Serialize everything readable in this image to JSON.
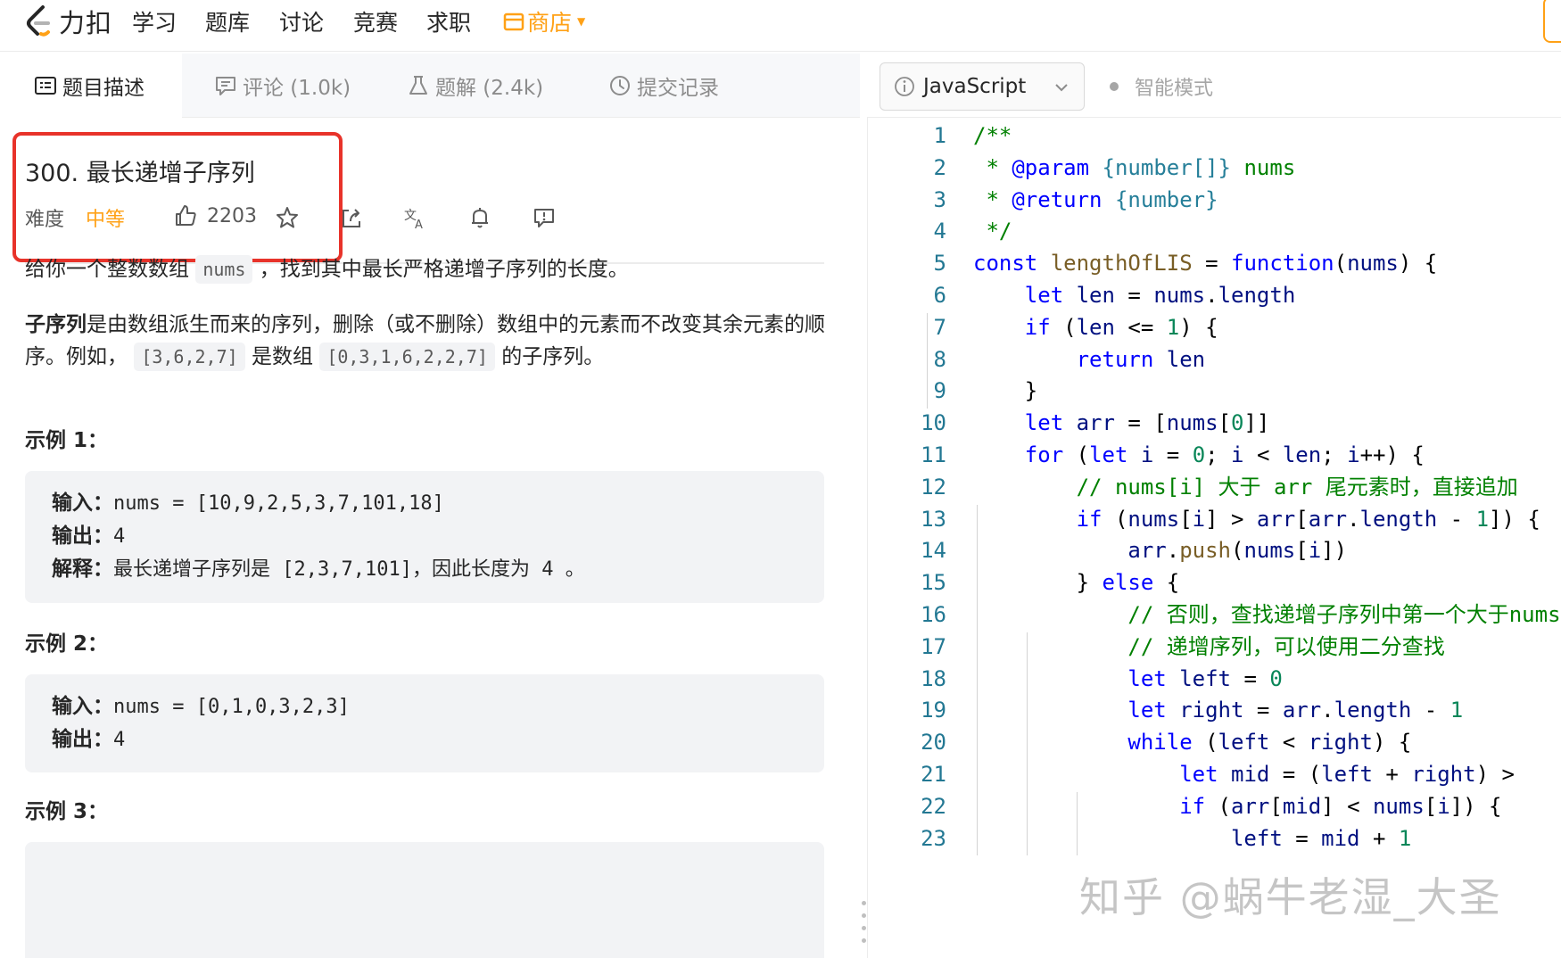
{
  "nav": {
    "logo_text": "力扣",
    "items": [
      "学习",
      "题库",
      "讨论",
      "竞赛",
      "求职"
    ],
    "shop_label": "商店"
  },
  "tabs": [
    {
      "label": "题目描述",
      "icon": "description-icon"
    },
    {
      "label": "评论 (1.0k)",
      "icon": "comment-icon"
    },
    {
      "label": "题解 (2.4k)",
      "icon": "flask-icon"
    },
    {
      "label": "提交记录",
      "icon": "clock-icon"
    }
  ],
  "toolbar": {
    "language": "JavaScript",
    "mode": "智能模式"
  },
  "problem": {
    "title": "300. 最长递增子序列",
    "difficulty_label": "难度",
    "difficulty": "中等",
    "likes": "2203",
    "para1_pre": "给你一个整数数组",
    "para1_code": "nums",
    "para1_post": "，找到其中最长严格递增子序列的长度。",
    "para2_bold": "子序列",
    "para2_a": "是由数组派生而来的序列，删除（或不删除）数组中的元素而不改变其余元素的顺序。例如，",
    "para2_code1": "[3,6,2,7]",
    "para2_b": "是数组",
    "para2_code2": "[0,3,1,6,2,2,7]",
    "para2_c": "的子序列。"
  },
  "examples": [
    {
      "title": "示例 1：",
      "input_label": "输入：",
      "input": "nums = [10,9,2,5,3,7,101,18]",
      "output_label": "输出：",
      "output": "4",
      "explain_label": "解释：",
      "explain_a": "最长递增子序列是",
      "explain_code": " [2,3,7,101]",
      "explain_b": "，因此长度为",
      "explain_num": " 4 ",
      "explain_c": "。"
    },
    {
      "title": "示例 2：",
      "input_label": "输入：",
      "input": "nums = [0,1,0,3,2,3]",
      "output_label": "输出：",
      "output": "4"
    },
    {
      "title": "示例 3："
    }
  ],
  "code_lines": [
    "/**",
    " * @param {number[]} nums",
    " * @return {number}",
    " */",
    "const lengthOfLIS = function(nums) {",
    "    let len = nums.length",
    "    if (len <= 1) {",
    "        return len",
    "    }",
    "    let arr = [nums[0]]",
    "    for (let i = 0; i < len; i++) {",
    "        // nums[i] 大于 arr 尾元素时，直接追加",
    "        if (nums[i] > arr[arr.length - 1]) {",
    "            arr.push(nums[i])",
    "        } else {",
    "            // 否则，查找递增子序列中第一个大于nums[i]",
    "            // 递增序列，可以使用二分查找",
    "            let left = 0",
    "            let right = arr.length - 1",
    "            while (left < right) {",
    "                let mid = (left + right) >",
    "                if (arr[mid] < nums[i]) {",
    "                    left = mid + 1"
  ],
  "watermark": "知乎 @蜗牛老湿_大圣",
  "colors": {
    "accent": "#ffa116",
    "highlight_box": "#e8332a",
    "keyword": "#0000ff",
    "comment": "#008000",
    "number": "#098658",
    "string": "#a31515",
    "line_number": "#237893"
  }
}
